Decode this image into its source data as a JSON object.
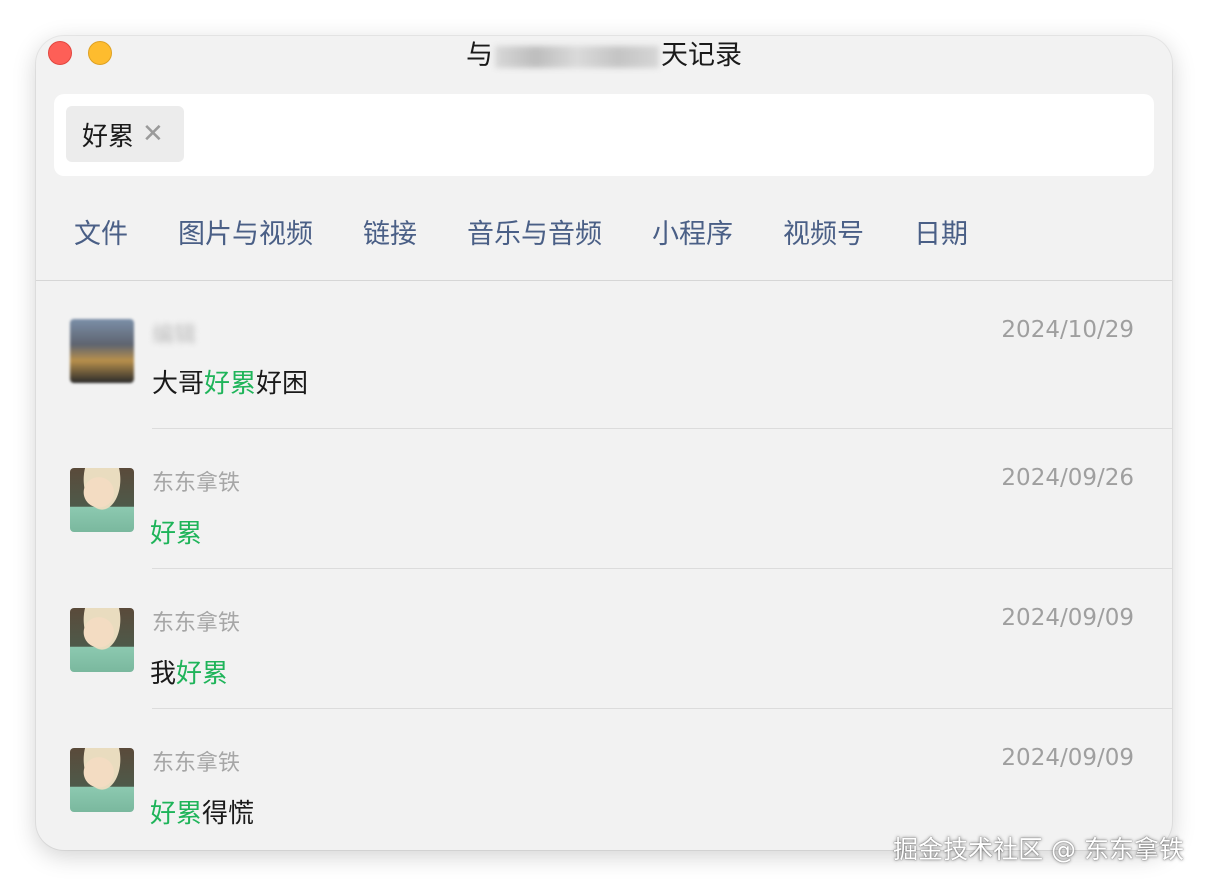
{
  "window": {
    "title_prefix": "与",
    "title_suffix": "天记录"
  },
  "search": {
    "chip_label": "好累",
    "chip_close_icon": "close-icon"
  },
  "filters": [
    "文件",
    "图片与视频",
    "链接",
    "音乐与音频",
    "小程序",
    "视频号",
    "日期"
  ],
  "results": [
    {
      "sender": "",
      "date": "2024/10/29",
      "before": "大哥",
      "highlight": "好累",
      "after": "好困"
    },
    {
      "sender": "东东拿铁",
      "date": "2024/09/26",
      "before": "",
      "highlight": "好累",
      "after": ""
    },
    {
      "sender": "东东拿铁",
      "date": "2024/09/09",
      "before": "我",
      "highlight": "好累",
      "after": ""
    },
    {
      "sender": "东东拿铁",
      "date": "2024/09/09",
      "before": "",
      "highlight": "好累",
      "after": "得慌"
    }
  ],
  "watermark": "掘金技术社区 @ 东东拿铁",
  "colors": {
    "highlight": "#1fb45a",
    "filter_text": "#4a5f86",
    "close_button": "#fe5f57",
    "minimize_button": "#febc2e"
  }
}
